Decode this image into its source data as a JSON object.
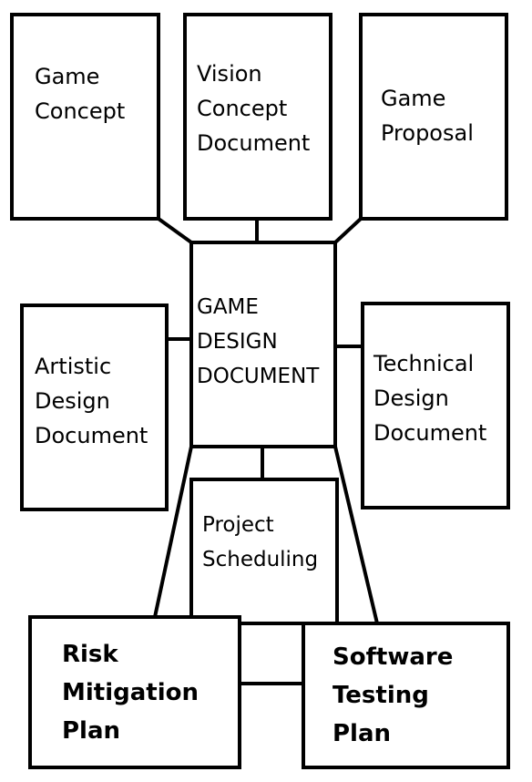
{
  "nodes": {
    "game_concept": "Game\nConcept",
    "vision_concept_document": "Vision\nConcept\nDocument",
    "game_proposal": "Game\nProposal",
    "game_design_document": "GAME\nDESIGN\nDOCUMENT",
    "artistic_design_document": "Artistic\nDesign\nDocument",
    "technical_design_document": "Technical\nDesign\nDocument",
    "project_scheduling": "Project\nScheduling",
    "risk_mitigation_plan": "Risk\nMitigation\nPlan",
    "software_testing_plan": "Software\nTesting\nPlan"
  },
  "colors": {
    "stroke": "#000000",
    "fill": "#ffffff"
  }
}
